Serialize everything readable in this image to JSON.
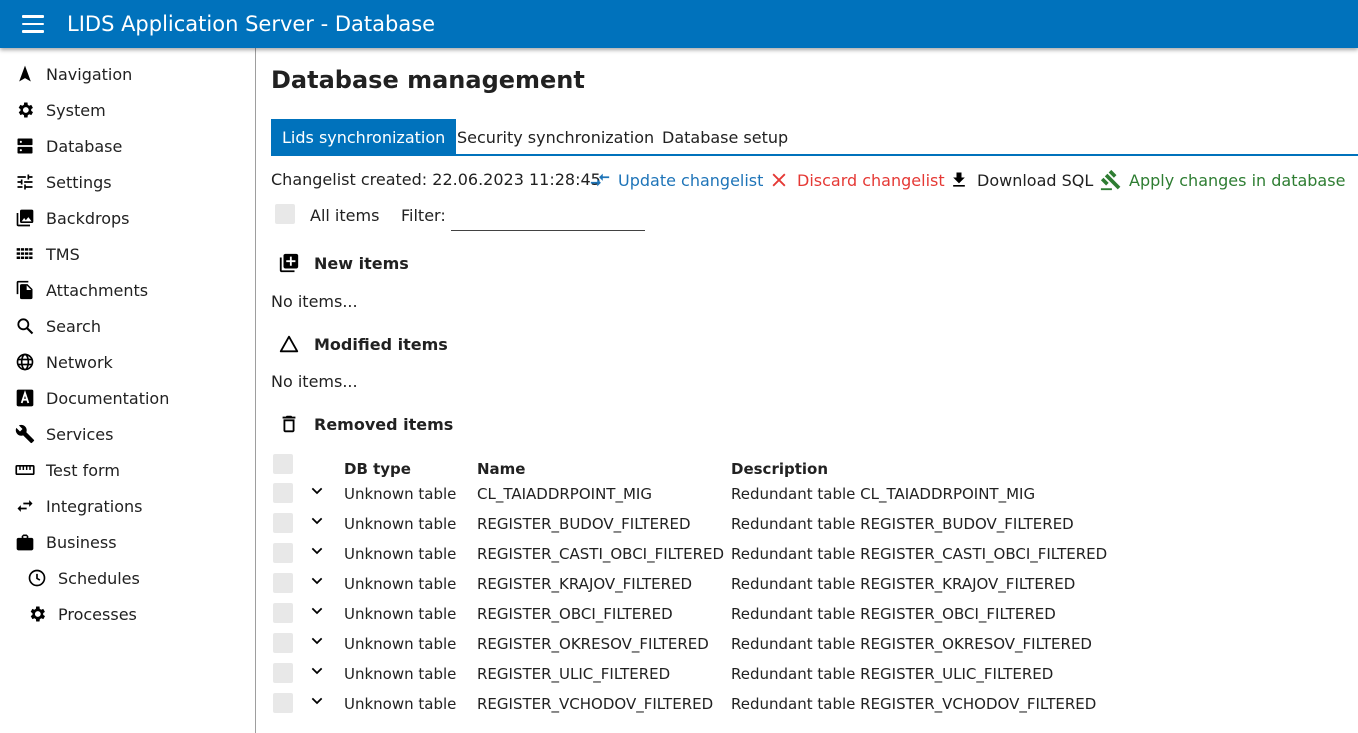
{
  "header": {
    "title": "LIDS Application Server - Database",
    "menu_icon": "hamburger-menu-icon"
  },
  "sidebar": {
    "items": [
      {
        "label": "Navigation",
        "icon": "navigation-arrow-icon"
      },
      {
        "label": "System",
        "icon": "gear-icon"
      },
      {
        "label": "Database",
        "icon": "database-icon"
      },
      {
        "label": "Settings",
        "icon": "sliders-icon"
      },
      {
        "label": "Backdrops",
        "icon": "image-stack-icon"
      },
      {
        "label": "TMS",
        "icon": "grid-icon"
      },
      {
        "label": "Attachments",
        "icon": "files-icon"
      },
      {
        "label": "Search",
        "icon": "search-icon"
      },
      {
        "label": "Network",
        "icon": "globe-icon"
      },
      {
        "label": "Documentation",
        "icon": "letter-a-icon"
      },
      {
        "label": "Services",
        "icon": "wrench-icon"
      },
      {
        "label": "Test form",
        "icon": "ruler-icon"
      },
      {
        "label": "Integrations",
        "icon": "swap-arrows-icon"
      },
      {
        "label": "Business",
        "icon": "briefcase-icon"
      },
      {
        "label": "Schedules",
        "icon": "clock-icon"
      },
      {
        "label": "Processes",
        "icon": "gear-icon"
      }
    ]
  },
  "main": {
    "title": "Database management",
    "tabs": [
      {
        "label": "Lids synchronization",
        "active": true
      },
      {
        "label": "Security synchronization",
        "active": false
      },
      {
        "label": "Database setup",
        "active": false
      }
    ],
    "changelist_created": "Changelist created: 22.06.2023 11:28:45",
    "actions": {
      "update": "Update changelist",
      "discard": "Discard changelist",
      "download": "Download SQL",
      "apply": "Apply changes in database"
    },
    "colors": {
      "accent": "#0072bc",
      "link": "#1e74b8",
      "danger": "#e53935",
      "success": "#2e7d32"
    },
    "all_items_label": "All items",
    "filter_label": "Filter:",
    "filter_value": "",
    "sections": {
      "new_items": {
        "title": "New items",
        "empty": "No items..."
      },
      "modified_items": {
        "title": "Modified items",
        "empty": "No items..."
      },
      "removed_items": {
        "title": "Removed items"
      }
    },
    "table": {
      "columns": [
        "DB type",
        "Name",
        "Description"
      ],
      "rows": [
        {
          "db_type": "Unknown table",
          "name": "CL_TAIADDRPOINT_MIG",
          "description": "Redundant table CL_TAIADDRPOINT_MIG"
        },
        {
          "db_type": "Unknown table",
          "name": "REGISTER_BUDOV_FILTERED",
          "description": "Redundant table REGISTER_BUDOV_FILTERED"
        },
        {
          "db_type": "Unknown table",
          "name": "REGISTER_CASTI_OBCI_FILTERED",
          "description": "Redundant table REGISTER_CASTI_OBCI_FILTERED"
        },
        {
          "db_type": "Unknown table",
          "name": "REGISTER_KRAJOV_FILTERED",
          "description": "Redundant table REGISTER_KRAJOV_FILTERED"
        },
        {
          "db_type": "Unknown table",
          "name": "REGISTER_OBCI_FILTERED",
          "description": "Redundant table REGISTER_OBCI_FILTERED"
        },
        {
          "db_type": "Unknown table",
          "name": "REGISTER_OKRESOV_FILTERED",
          "description": "Redundant table REGISTER_OKRESOV_FILTERED"
        },
        {
          "db_type": "Unknown table",
          "name": "REGISTER_ULIC_FILTERED",
          "description": "Redundant table REGISTER_ULIC_FILTERED"
        },
        {
          "db_type": "Unknown table",
          "name": "REGISTER_VCHODOV_FILTERED",
          "description": "Redundant table REGISTER_VCHODOV_FILTERED"
        }
      ]
    }
  }
}
